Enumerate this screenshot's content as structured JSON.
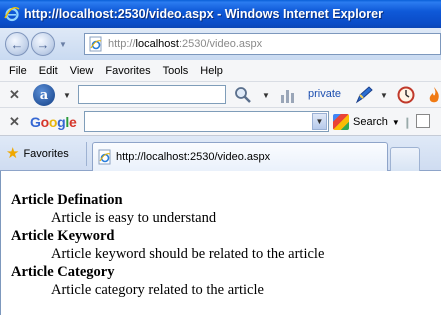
{
  "window": {
    "title": "http://localhost:2530/video.aspx - Windows Internet Explorer"
  },
  "address_bar": {
    "url_prefix": "http://",
    "url_host": "localhost",
    "url_rest": ":2530/video.aspx"
  },
  "menu": [
    "File",
    "Edit",
    "View",
    "Favorites",
    "Tools",
    "Help"
  ],
  "ask_toolbar": {
    "search_value": "",
    "private_label": "private"
  },
  "google_toolbar": {
    "logo": [
      "G",
      "o",
      "o",
      "g",
      "l",
      "e"
    ],
    "search_value": "",
    "search_label": "Search"
  },
  "tab_row": {
    "favorites_label": "Favorites",
    "active_tab_title": "http://localhost:2530/video.aspx"
  },
  "article": {
    "items": [
      {
        "term": "Article Defination",
        "description": "Article is easy to understand"
      },
      {
        "term": "Article Keyword",
        "description": "Article keyword should be related to the article"
      },
      {
        "term": "Article Category",
        "description": "Article category related to the article"
      }
    ]
  },
  "colors": {
    "titlebar": "#0a4cc7",
    "link": "#1d4fb0"
  }
}
